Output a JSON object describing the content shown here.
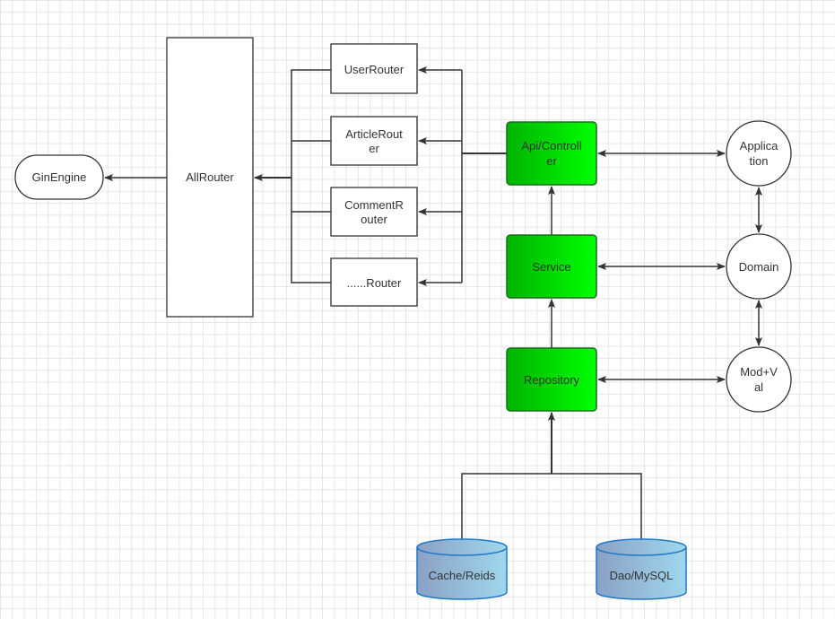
{
  "colors": {
    "green_start": "#00b400",
    "green_end": "#00ff00",
    "green_border": "#1f6b1f",
    "db_start": "#8aa0c4",
    "db_end": "#9fd8ee",
    "db_border": "#1f78c8",
    "line": "#333333"
  },
  "nodes": {
    "gin_engine": "GinEngine",
    "all_router": "AllRouter",
    "user_router": "UserRouter",
    "article_router": [
      "ArticleRout",
      "er"
    ],
    "comment_router": [
      "CommentR",
      "outer"
    ],
    "other_router": "......Router",
    "api_controller": [
      "Api/Controll",
      "er"
    ],
    "service": "Service",
    "repository": "Repository",
    "application": [
      "Applica",
      "tion"
    ],
    "domain": "Domain",
    "mod_val": [
      "Mod+V",
      "al"
    ],
    "cache": "Cache/Reids",
    "dao": "Dao/MySQL"
  }
}
